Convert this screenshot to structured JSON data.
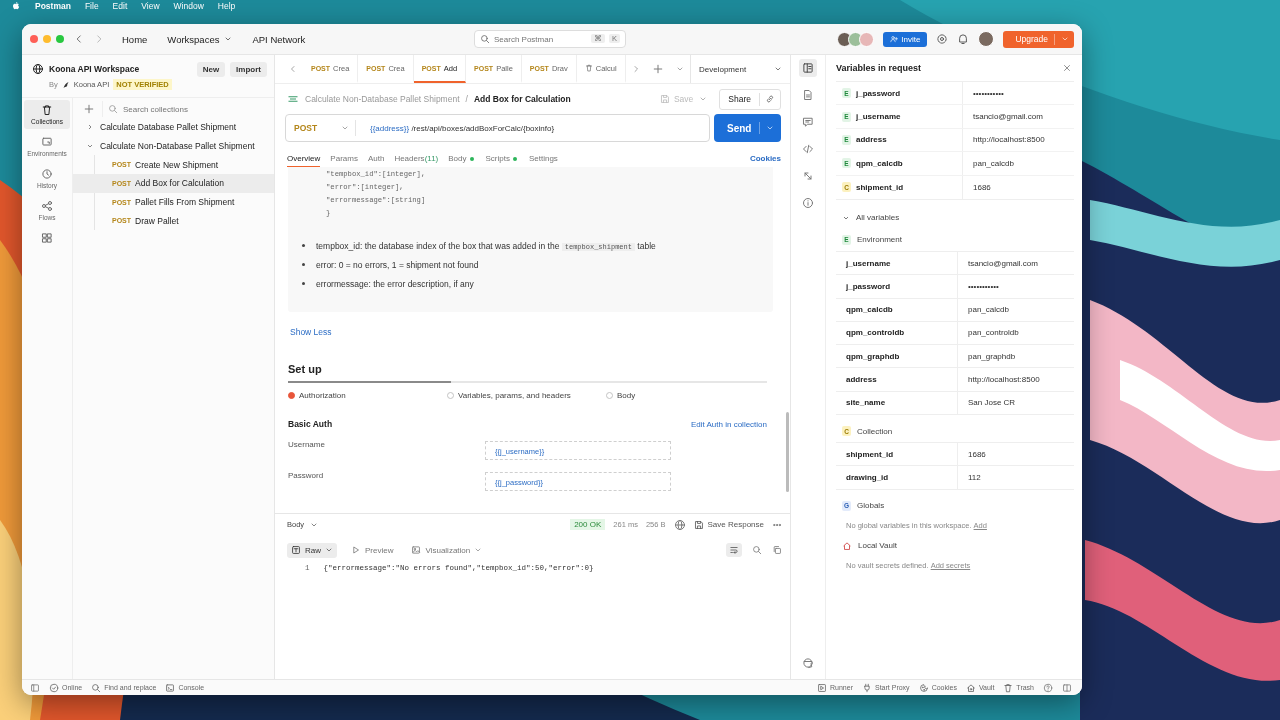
{
  "menu_bar": {
    "app": "Postman",
    "items": [
      "File",
      "Edit",
      "View",
      "Window",
      "Help"
    ]
  },
  "title_bar": {
    "nav": [
      {
        "label": "Home",
        "caret": false
      },
      {
        "label": "Workspaces",
        "caret": true
      },
      {
        "label": "API Network",
        "caret": false
      }
    ],
    "search": {
      "placeholder": "Search Postman",
      "keys": [
        "⌘",
        "K"
      ]
    },
    "invite": "Invite",
    "upgrade": "Upgrade"
  },
  "workspace": {
    "name": "Koona API Workspace",
    "new": "New",
    "import": "Import",
    "by": "By",
    "owner": "Koona API",
    "badge": "NOT VERIFIED"
  },
  "sidebar_rail": [
    {
      "kind": "collections",
      "label": "Collections",
      "selected": true
    },
    {
      "kind": "environments",
      "label": "Environments",
      "selected": false
    },
    {
      "kind": "history",
      "label": "History",
      "selected": false
    },
    {
      "kind": "flows",
      "label": "Flows",
      "selected": false
    },
    {
      "kind": "grid",
      "selected": false
    }
  ],
  "collections": {
    "search_placeholder": "Search collections",
    "tree": [
      {
        "name": "Calculate Database Pallet Shipment",
        "expanded": false
      },
      {
        "name": "Calculate Non-Database Pallet Shipment",
        "expanded": true,
        "children": [
          {
            "method": "POST",
            "name": "Create New Shipment",
            "selected": false
          },
          {
            "method": "POST",
            "name": "Add Box for Calculation",
            "selected": true
          },
          {
            "method": "POST",
            "name": "Pallet Fills From Shipment",
            "selected": false
          },
          {
            "method": "POST",
            "name": "Draw Pallet",
            "selected": false
          }
        ]
      }
    ]
  },
  "request_tabs": [
    {
      "kind": "request",
      "method": "POST",
      "label": "Crea",
      "selected": false
    },
    {
      "kind": "request",
      "method": "POST",
      "label": "Crea",
      "selected": false
    },
    {
      "kind": "request",
      "method": "POST",
      "label": "Add",
      "selected": true
    },
    {
      "kind": "request",
      "method": "POST",
      "label": "Palle",
      "selected": false
    },
    {
      "kind": "request",
      "method": "POST",
      "label": "Drav",
      "selected": false
    },
    {
      "kind": "collection",
      "label": "Calcul",
      "selected": false
    }
  ],
  "environment": "Development",
  "breadcrumb": {
    "parent": "Calculate Non-Database Pallet Shipment",
    "separator": "/",
    "current": "Add Box for Calculation"
  },
  "save": {
    "label": "Save",
    "disabled": true
  },
  "share": "Share",
  "request": {
    "method": "POST",
    "url_variable": "{{address}}",
    "url_path": "/rest/api/boxes/addBoxForCalc/{boxinfo}",
    "send": "Send"
  },
  "section_tabs": [
    {
      "label": "Overview",
      "selected": true,
      "dot": false
    },
    {
      "label": "Params",
      "selected": false,
      "dot": false
    },
    {
      "label": "Auth",
      "selected": false,
      "dot": false
    },
    {
      "label": "Headers",
      "count": "(11)",
      "selected": false,
      "dot": false
    },
    {
      "label": "Body",
      "selected": false,
      "dot": true
    },
    {
      "label": "Scripts",
      "selected": false,
      "dot": true
    },
    {
      "label": "Settings",
      "selected": false,
      "dot": false
    }
  ],
  "cookies": "Cookies",
  "docs": {
    "code_lines": [
      "\"tempbox_id\":[integer],",
      "\"error\":[integer],",
      "\"errormessage\":[string]",
      "}"
    ],
    "bullets": [
      [
        {
          "kind": "text",
          "text": "tempbox_id: the database index of the box that was added in the "
        },
        {
          "kind": "code",
          "text": "tempbox_shipment"
        },
        {
          "kind": "text",
          "text": " table"
        }
      ],
      [
        {
          "kind": "text",
          "text": "error: 0 = no errors, 1 = shipment not found"
        }
      ],
      [
        {
          "kind": "text",
          "text": "errormessage: the error description, if any"
        }
      ]
    ],
    "show_less": "Show Less"
  },
  "setup": {
    "title": "Set up",
    "level": 0.34,
    "options": [
      {
        "label": "Authorization",
        "selected": true
      },
      {
        "label": "Variables, params, and headers",
        "selected": false
      },
      {
        "label": "Body",
        "selected": false
      }
    ],
    "auth_title": "Basic Auth",
    "edit_link": "Edit Auth in collection",
    "fields": [
      {
        "label": "Username",
        "value": "{{j_username}}"
      },
      {
        "label": "Password",
        "value": "{{j_password}}"
      }
    ]
  },
  "response": {
    "view": "Body",
    "status": "200 OK",
    "time": "261 ms",
    "size": "256 B",
    "save": "Save Response",
    "formats": [
      {
        "label": "Raw",
        "selected": true,
        "caret": true
      },
      {
        "label": "Preview",
        "selected": false,
        "caret": false
      },
      {
        "label": "Visualization",
        "selected": false,
        "caret": true
      }
    ],
    "lines": [
      {
        "number": "1",
        "text": "{\"errormessage\":\"No errors found\",\"tempbox_id\":50,\"error\":0}"
      }
    ]
  },
  "right_rail": [
    {
      "kind": "variables",
      "selected": true
    },
    {
      "kind": "docs",
      "selected": false
    },
    {
      "kind": "comments",
      "selected": false
    },
    {
      "kind": "code",
      "selected": false
    },
    {
      "kind": "related",
      "selected": false
    },
    {
      "kind": "info",
      "selected": false
    }
  ],
  "variables_panel": {
    "title": "Variables in request",
    "request_vars": [
      {
        "kind": "environment",
        "badge": "E",
        "name": "j_password",
        "value": "•••••••••••"
      },
      {
        "kind": "environment",
        "badge": "E",
        "name": "j_username",
        "value": "tsancio@gmail.com"
      },
      {
        "kind": "environment",
        "badge": "E",
        "name": "address",
        "value": "http://localhost:8500"
      },
      {
        "kind": "environment",
        "badge": "E",
        "name": "qpm_calcdb",
        "value": "pan_calcdb"
      },
      {
        "kind": "collection",
        "badge": "C",
        "name": "shipment_id",
        "value": "1686"
      }
    ],
    "all_label": "All variables",
    "all_expanded": true,
    "groups": [
      {
        "kind": "environment",
        "badge": "E",
        "name": "Environment",
        "vars": [
          {
            "name": "j_username",
            "value": "tsancio@gmail.com"
          },
          {
            "name": "j_password",
            "value": "•••••••••••"
          },
          {
            "name": "qpm_calcdb",
            "value": "pan_calcdb"
          },
          {
            "name": "qpm_controldb",
            "value": "pan_controldb"
          },
          {
            "name": "qpm_graphdb",
            "value": "pan_graphdb"
          },
          {
            "name": "address",
            "value": "http://localhost:8500"
          },
          {
            "name": "site_name",
            "value": "San Jose CR"
          }
        ]
      },
      {
        "kind": "collection",
        "badge": "C",
        "name": "Collection",
        "vars": [
          {
            "name": "shipment_id",
            "value": "1686"
          },
          {
            "name": "drawing_id",
            "value": "112"
          }
        ]
      },
      {
        "kind": "global",
        "badge": "G",
        "name": "Globals",
        "empty": "No global variables in this workspace.",
        "link": "Add"
      },
      {
        "kind": "vault",
        "name": "Local Vault",
        "empty": "No vault secrets defined.",
        "link": "Add secrets"
      }
    ]
  },
  "status_bar": {
    "left": [
      {
        "kind": "online",
        "label": "Online"
      },
      {
        "kind": "find",
        "label": "Find and replace"
      },
      {
        "kind": "console",
        "label": "Console"
      }
    ],
    "right": [
      {
        "kind": "runner",
        "label": "Runner"
      },
      {
        "kind": "proxy",
        "label": "Start Proxy"
      },
      {
        "kind": "cookies",
        "label": "Cookies"
      },
      {
        "kind": "vault",
        "label": "Vault"
      },
      {
        "kind": "trash",
        "label": "Trash"
      }
    ]
  }
}
